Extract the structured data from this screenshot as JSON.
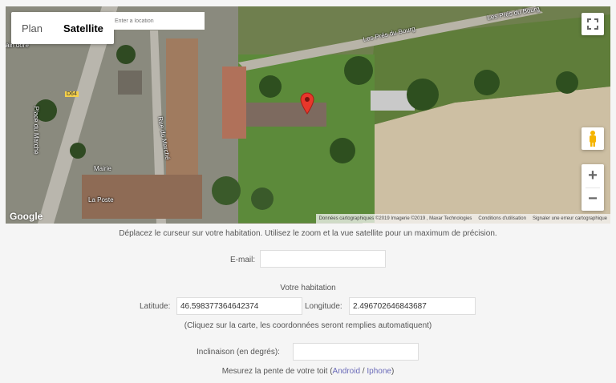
{
  "map": {
    "maptype_tabs": [
      "Plan",
      "Satellite"
    ],
    "active_tab": "Satellite",
    "search_placeholder": "Enter a location",
    "labels": {
      "road_top": "Les Prés du Bourg",
      "road_top_right": "Les Prés du Bourg",
      "d64": "D64",
      "mairie": "Mairie",
      "la_poste": "La Poste",
      "place_du_marche": "Place du Marché",
      "rue_du_marche": "Rue du Marché",
      "ain_dore": "ain doré"
    },
    "google": "Google",
    "attribution": {
      "data": "Données cartographiques ©2019 Imagerie ©2019 , Maxar Technologies",
      "terms": "Conditions d'utilisation",
      "report": "Signaler une erreur cartographique"
    },
    "zoom_in": "+",
    "zoom_out": "−"
  },
  "form": {
    "instructions": "Déplacez le curseur sur votre habitation. Utilisez le zoom et la vue satellite pour un maximum de précision.",
    "email_label": "E-mail:",
    "email_value": "",
    "habitation_heading": "Votre habitation",
    "latitude_label": "Latitude:",
    "latitude_value": "46.598377364642374",
    "longitude_label": "Longitude:",
    "longitude_value": "2.496702646843687",
    "coords_note": "(Cliquez sur la carte, les coordonnées seront remplies automatiquent)",
    "inclinaison_label": "Inclinaison (en degrés):",
    "inclinaison_value": "",
    "slope_text_before": "Mesurez la pente de votre toit (",
    "android_link": "Android",
    "separator": " / ",
    "iphone_link": "Iphone",
    "slope_text_after": ")"
  }
}
